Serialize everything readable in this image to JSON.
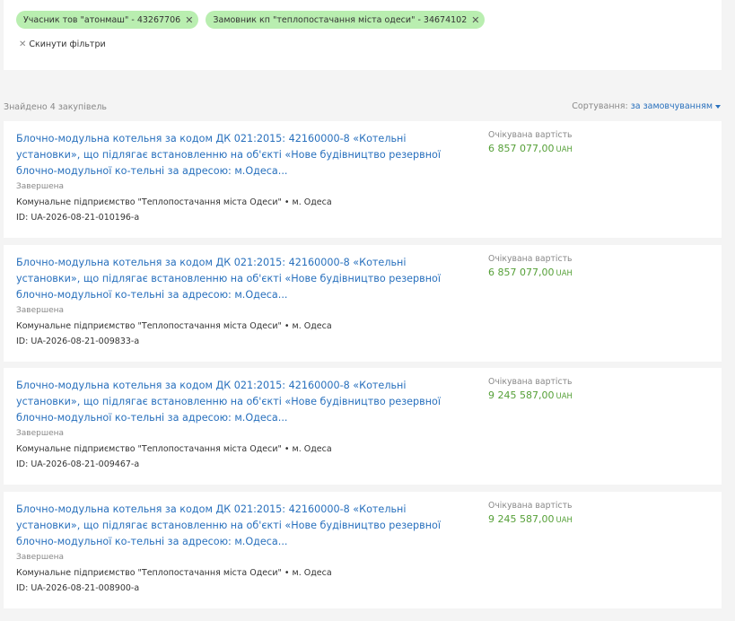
{
  "filters": {
    "chips": [
      {
        "label": "Учасник тов \"атонмаш\" - 43267706"
      },
      {
        "label": "Замовник кп \"теплопостачання міста одеси\" - 34674102"
      }
    ],
    "reset_label": "Скинути фільтри"
  },
  "results": {
    "found_text": "Знайдено 4 закупівель",
    "sort_label": "Сортування:",
    "sort_value": "за замовчуванням"
  },
  "tenders": [
    {
      "title": "Блочно-модульна котельня за кодом ДК 021:2015: 42160000-8 «Котельні установки», що підлягає встановленню на об'єкті «Нове будівництво резервної блочно-модульної ко-тельні за адресою: м.Одеса...",
      "status": "Завершена",
      "organization": "Комунальне підприємство \"Теплопостачання міста Одеси\" • м. Одеса",
      "id": "ID: UA-2026-08-21-010196-a",
      "price_label": "Очікувана вартість",
      "amount": "6 857 077,00",
      "currency": "UAH"
    },
    {
      "title": "Блочно-модульна котельня за кодом ДК 021:2015: 42160000-8 «Котельні установки», що підлягає встановленню на об'єкті «Нове будівництво резервної блочно-модульної ко-тельні за адресою: м.Одеса...",
      "status": "Завершена",
      "organization": "Комунальне підприємство \"Теплопостачання міста Одеси\" • м. Одеса",
      "id": "ID: UA-2026-08-21-009833-a",
      "price_label": "Очікувана вартість",
      "amount": "6 857 077,00",
      "currency": "UAH"
    },
    {
      "title": "Блочно-модульна котельня за кодом ДК 021:2015: 42160000-8 «Котельні установки», що підлягає встановленню на об'єкті «Нове будівництво резервної блочно-модульної ко-тельні за адресою: м.Одеса...",
      "status": "Завершена",
      "organization": "Комунальне підприємство \"Теплопостачання міста Одеси\" • м. Одеса",
      "id": "ID: UA-2026-08-21-009467-a",
      "price_label": "Очікувана вартість",
      "amount": "9 245 587,00",
      "currency": "UAH"
    },
    {
      "title": "Блочно-модульна котельня за кодом ДК 021:2015: 42160000-8 «Котельні установки», що підлягає встановленню на об'єкті «Нове будівництво резервної блочно-модульної ко-тельні за адресою: м.Одеса...",
      "status": "Завершена",
      "organization": "Комунальне підприємство \"Теплопостачання міста Одеси\" • м. Одеса",
      "id": "ID: UA-2026-08-21-008900-a",
      "price_label": "Очікувана вартість",
      "amount": "9 245 587,00",
      "currency": "UAH"
    }
  ],
  "colors": {
    "link": "#2870bd",
    "amount": "#56a038",
    "chip_bg": "#b9eeb0",
    "page_bg": "#f4f4f4"
  }
}
